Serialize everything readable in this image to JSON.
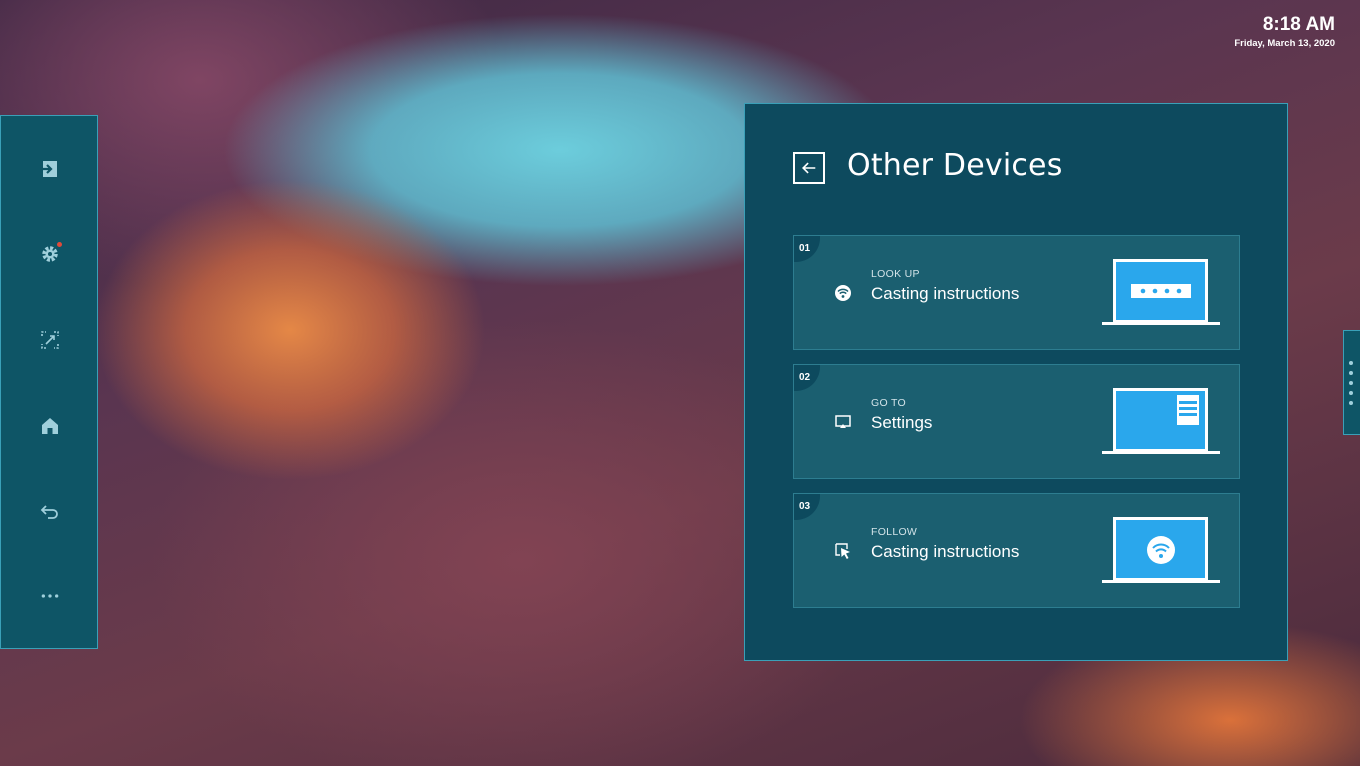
{
  "clock": {
    "time": "8:18 AM",
    "date": "Friday, March 13, 2020"
  },
  "sidebar": {
    "items": [
      {
        "icon": "sign-in-icon",
        "label": ""
      },
      {
        "icon": "gear-icon",
        "label": "",
        "badge": "notification-dot"
      },
      {
        "icon": "screen-share-icon",
        "label": ""
      },
      {
        "icon": "home-icon",
        "label": ""
      },
      {
        "icon": "undo-icon",
        "label": ""
      },
      {
        "icon": "more-icon",
        "label": ""
      }
    ]
  },
  "panel": {
    "title": "Other Devices",
    "back_icon": "back-arrow-icon",
    "cards": [
      {
        "number": "01",
        "eyebrow": "LOOK UP",
        "label": "Casting instructions",
        "icon": "wifi-icon",
        "illustration": "laptop-password-dots"
      },
      {
        "number": "02",
        "eyebrow": "GO TO",
        "label": "Settings",
        "icon": "cast-screen-icon",
        "illustration": "laptop-settings-panel"
      },
      {
        "number": "03",
        "eyebrow": "FOLLOW",
        "label": "Casting instructions",
        "icon": "cursor-click-icon",
        "illustration": "laptop-wifi"
      }
    ]
  },
  "colors": {
    "panel_bg": "#0d4a5e",
    "card_bg": "#1b5f70",
    "accent_border": "#3aa0b8",
    "laptop_screen": "#2aa7ec",
    "notification": "#e04a3a"
  }
}
